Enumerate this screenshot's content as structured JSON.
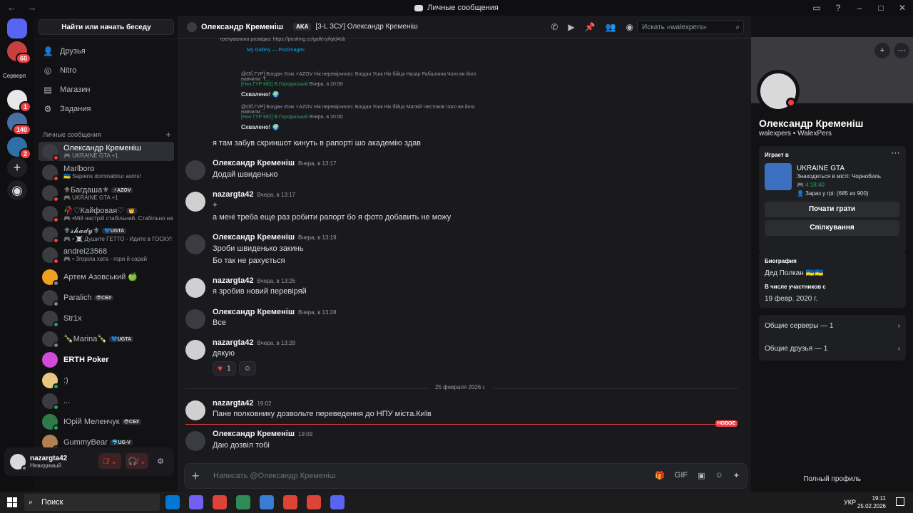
{
  "window": {
    "title": "Личные сообщения",
    "nav": "← →"
  },
  "servers": {
    "home_badge": "",
    "items": [
      {
        "badge": "60"
      },
      {
        "label": "Серверп"
      },
      {
        "badge": "1"
      },
      {
        "badge": "140"
      },
      {
        "badge": "2"
      }
    ]
  },
  "dm_panel": {
    "search": "Найти или начать беседу",
    "menu": [
      {
        "label": "Друзья",
        "icon": "friends-icon"
      },
      {
        "label": "Nitro",
        "icon": "nitro-icon"
      },
      {
        "label": "Магазин",
        "icon": "shop-icon"
      },
      {
        "label": "Задания",
        "icon": "quests-icon"
      }
    ],
    "header": "Личные сообщения",
    "dms": [
      {
        "name": "Олександр Кременіш",
        "sub": "🎮 UKRAINE GTA  +1",
        "status": "dnd",
        "active": true
      },
      {
        "name": "Marlboro",
        "sub": "🇺🇦 Sapiens dominabitur astris!",
        "status": "dnd"
      },
      {
        "name": "⚜Багдаша⚜",
        "tag": "⚡AZOV",
        "sub": "🎮 UKRAINE GTA  +1",
        "status": "dnd"
      },
      {
        "name": "🥀♡Кайфовая♡",
        "tag": "👑",
        "sub": "🎮 •Мій настрій стабільний. Стабільно на",
        "status": "dnd"
      },
      {
        "name": "⚜𝓼𝓱𝓪𝓭𝔂⚜",
        "tag": "💙UGTA",
        "sub": "🎮 • ☠️ Душите ГЕТТО - Идите в ГОСКУ!",
        "status": "dnd"
      },
      {
        "name": "andrei23568",
        "sub": "🎮 • Згоріла хата - гори й сарай",
        "status": "dnd"
      },
      {
        "name": "Артем Азовський 🍏",
        "sub": "",
        "status": "idle"
      },
      {
        "name": "Paralich",
        "tag": "😎СБУ",
        "sub": "",
        "status": "idle"
      },
      {
        "name": "Str1x",
        "sub": "",
        "status": "online"
      },
      {
        "name": "🍾Marina🍾",
        "tag": "💙UGTA",
        "sub": "",
        "status": "idle"
      },
      {
        "name": "ERTH Poker",
        "sub": "",
        "status": "none"
      },
      {
        "name": ":)",
        "sub": "",
        "status": "online"
      },
      {
        "name": "...",
        "sub": "",
        "status": "online"
      },
      {
        "name": "Юрій Меленчук",
        "tag": "😎СБУ",
        "sub": "",
        "status": "online"
      },
      {
        "name": "GummyBear",
        "tag": "🐬UG-V",
        "sub": "",
        "status": "online"
      }
    ],
    "user": {
      "name": "nazargta42",
      "status": "Невидимый"
    }
  },
  "chat": {
    "header": {
      "name": "Олександр Кременіш",
      "aka_label": "AKA",
      "aka_value": "[3-L ЗСУ] Олександр Кременіш",
      "search_placeholder": "Искать «walexpers»"
    },
    "embed": {
      "line1": "тренувальна розвідка: https://postimg.cc/gallery/lqtd4sb",
      "link_title": "My Gallery — Postimages",
      "reply1": "@Об.ГУР] Богдан Усик ⚡AZOV  Нік перевірчного: Богдан Усик Нік бійця Назар Рабшлина Чого ви його навчили: Т...",
      "reply1_author": "[Нач.ГУР МО] В.Городиський",
      "reply1_time": "Вчера, в 20:50",
      "reply1_text": "Схвалено! 🌍",
      "reply2": "@Об.ГУР] Богдан Усик ⚡AZOV  Нік перевірчного: Богдан Усик Нік бійця Матвій Честоков Чого ви його навчили:...",
      "reply2_author": "[Нач.ГУР МО] В.Городиський",
      "reply2_time": "Вчера, в 20:50",
      "reply2_text": "Схвалено! 🌍"
    },
    "messages": [
      {
        "author": "",
        "time": "",
        "text": "я там забув скриншот кинуть в рапорті шо академію здав"
      },
      {
        "author": "Олександр Кременіш",
        "time": "Вчера, в 13:17",
        "text": "Додай швиденько"
      },
      {
        "author": "nazargta42",
        "time": "Вчера, в 13:17",
        "text": "+",
        "text2": "а мені треба еще раз робити рапорт бо я фото добавить не можу"
      },
      {
        "author": "Олександр Кременіш",
        "time": "Вчера, в 13:19",
        "text": "Зроби швиденько закинь",
        "text2": "Бо так не рахується"
      },
      {
        "author": "nazargta42",
        "time": "Вчера, в 13:26",
        "text": "я зробив новий перевіряй"
      },
      {
        "author": "Олександр Кременіш",
        "time": "Вчера, в 13:28",
        "text": "Все"
      },
      {
        "author": "nazargta42",
        "time": "Вчера, в 13:28",
        "text": "дякую"
      },
      {
        "author": "nazargta42",
        "time": "19:02",
        "text": "Пане полковнику дозвольте переведення до НПУ міста.Київ"
      },
      {
        "author": "Олександр Кременіш",
        "time": "19:09",
        "text": "Даю дозвіл тобі"
      }
    ],
    "reaction_count": "1",
    "date_divider": "25 февраля 2026 г.",
    "new_label": "НОВОЕ",
    "composer_placeholder": "Написать @Олександр Кременіш"
  },
  "profile": {
    "name": "Олександр Кременіш",
    "user": "walexpers • WalexPers",
    "playing_label": "Играет в",
    "game": "UKRAINE GTA",
    "game_sub": "Знаходиться в місті: Чорнобиль",
    "game_time": "🎮 4:18:40",
    "game_players": "👤 Зараз у грі: (685 из 900)",
    "play_btn": "Почати грати",
    "chat_btn": "Спілкування",
    "bio_label": "Биография",
    "bio": "Дед Полкан 🇺🇦🇺🇦",
    "member_label": "В числе участников с",
    "member_since": "19 февр. 2020 г.",
    "mutual_servers": "Общие серверы — 1",
    "mutual_friends": "Общие друзья — 1",
    "full_profile": "Полный профиль"
  },
  "taskbar": {
    "search": "Поиск",
    "lang": "УКР",
    "time": "19:11",
    "date": "25.02.2026"
  }
}
